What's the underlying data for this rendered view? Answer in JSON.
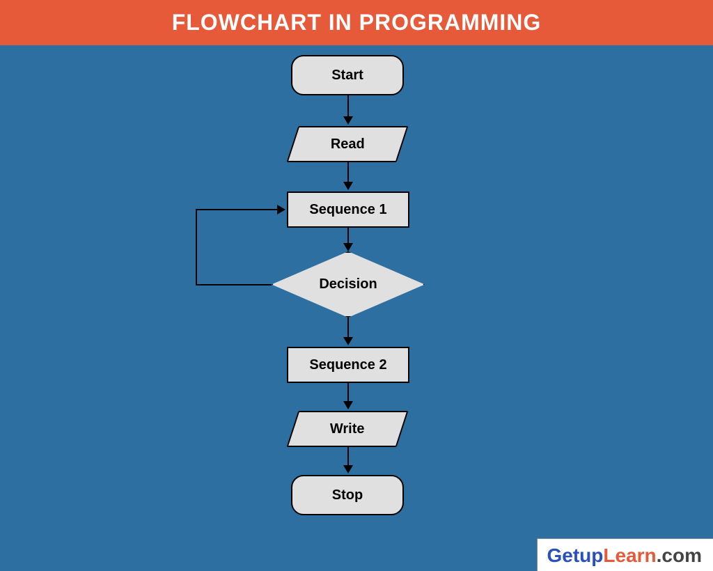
{
  "header": {
    "title": "FLOWCHART IN PROGRAMMING"
  },
  "nodes": {
    "start": {
      "label": "Start"
    },
    "read": {
      "label": "Read"
    },
    "seq1": {
      "label": "Sequence 1"
    },
    "decision": {
      "label": "Decision"
    },
    "seq2": {
      "label": "Sequence 2"
    },
    "write": {
      "label": "Write"
    },
    "stop": {
      "label": "Stop"
    }
  },
  "watermark": {
    "part1": "Getup",
    "part2": "Learn",
    "part3": ".com"
  },
  "colors": {
    "header_bg": "#e65a3a",
    "page_bg": "#2d6fa0",
    "node_fill": "#e0e0e0",
    "stroke": "#000000"
  },
  "flow": [
    {
      "from": "start",
      "to": "read"
    },
    {
      "from": "read",
      "to": "seq1"
    },
    {
      "from": "seq1",
      "to": "decision"
    },
    {
      "from": "decision",
      "to": "seq2"
    },
    {
      "from": "decision",
      "to": "seq1",
      "loop": true
    },
    {
      "from": "seq2",
      "to": "write"
    },
    {
      "from": "write",
      "to": "stop"
    }
  ]
}
